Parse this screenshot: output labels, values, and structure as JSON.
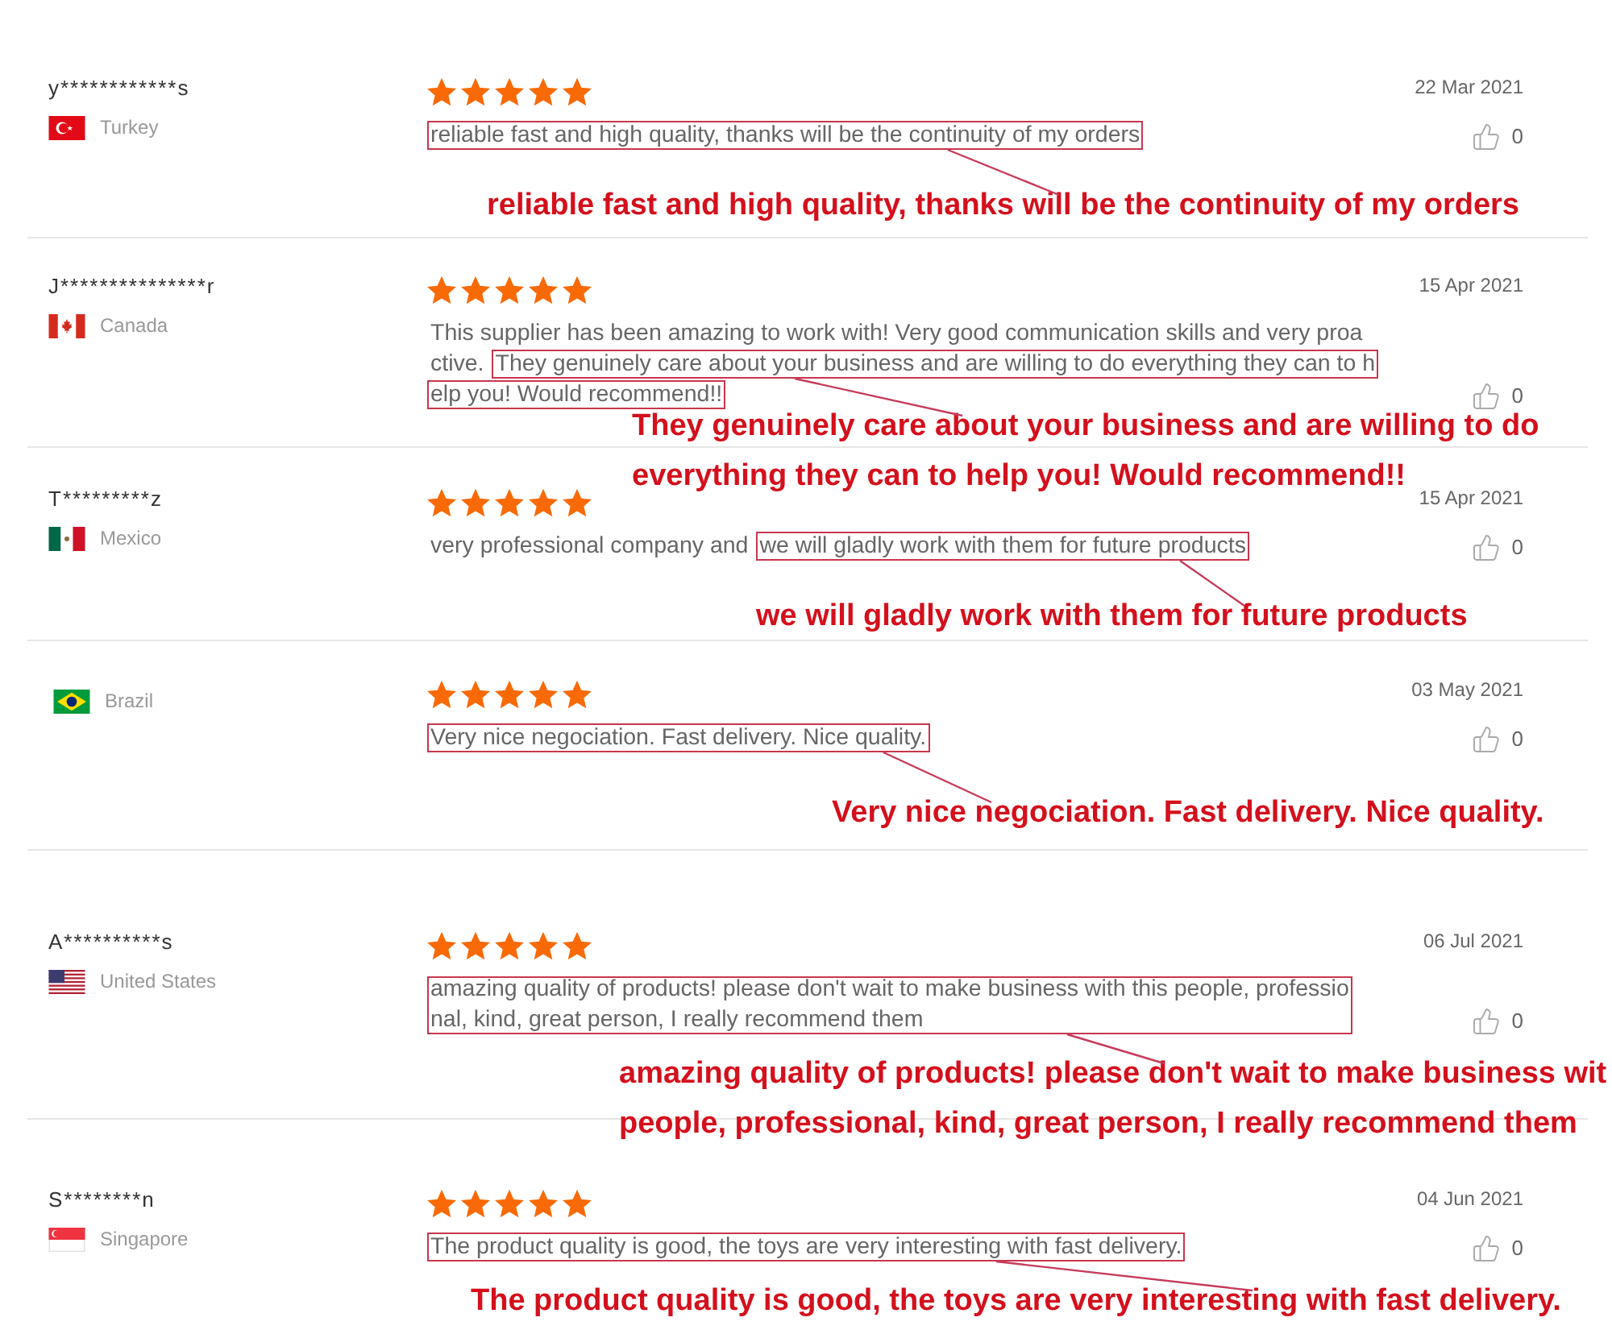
{
  "reviews": [
    {
      "name": "y************s",
      "country": "Turkey",
      "stars": 5,
      "date": "22 Mar 2021",
      "likes": "0",
      "text_lines": [
        [
          {
            "text": "reliable fast and high quality, thanks will be the continuity of my orders",
            "highlighted": true
          }
        ]
      ],
      "callout_lines": [
        "reliable fast and high quality, thanks will be the continuity of my orders"
      ]
    },
    {
      "name": "J***************r",
      "country": "Canada",
      "stars": 5,
      "date": "15 Apr 2021",
      "likes": "0",
      "text_lines": [
        [
          {
            "text": "This supplier has been amazing to work with! Very good communication skills and very proa",
            "highlighted": false
          }
        ],
        [
          {
            "text": "ctive.",
            "highlighted": false
          },
          {
            "text": "They genuinely care about your business and are willing to do everything they can to h",
            "highlighted": true
          }
        ],
        [
          {
            "text": "elp you! Would recommend!!",
            "highlighted": true
          }
        ]
      ],
      "callout_lines": [
        "They genuinely care about your business and are willing to do",
        "everything they can to help you! Would recommend!!"
      ]
    },
    {
      "name": "T*********z",
      "country": "Mexico",
      "stars": 5,
      "date": "15 Apr 2021",
      "likes": "0",
      "text_lines": [
        [
          {
            "text": "very professional company and",
            "highlighted": false
          },
          {
            "text": "we will gladly work with them for future products",
            "highlighted": true
          }
        ]
      ],
      "callout_lines": [
        "we will gladly work with them for future products"
      ]
    },
    {
      "country": "Brazil",
      "stars": 5,
      "date": "03 May 2021",
      "likes": "0",
      "text_lines": [
        [
          {
            "text": "Very nice negociation. Fast delivery. Nice quality.",
            "highlighted": true
          }
        ]
      ],
      "callout_lines": [
        "Very nice negociation. Fast delivery. Nice quality."
      ]
    },
    {
      "name": "A**********s",
      "country": "United States",
      "stars": 5,
      "date": "06 Jul 2021",
      "likes": "0",
      "text_lines": [
        [
          {
            "text": "amazing quality of products! please don't wait to make business with this people, professio",
            "highlighted": true
          }
        ],
        [
          {
            "text": "nal, kind, great person, I really recommend them",
            "highlighted": true
          }
        ]
      ],
      "callout_lines": [
        "amazing quality of products! please don't wait to make business wit",
        "people, professional, kind, great person, I really recommend them"
      ]
    },
    {
      "name": "S********n",
      "country": "Singapore",
      "stars": 5,
      "date": "04 Jun 2021",
      "likes": "0",
      "text_lines": [
        [
          {
            "text": "The product quality is good, the toys are very interesting with fast delivery.",
            "highlighted": true
          }
        ]
      ],
      "callout_lines": [
        "The product quality is good, the toys are very interesting with fast delivery."
      ]
    }
  ]
}
